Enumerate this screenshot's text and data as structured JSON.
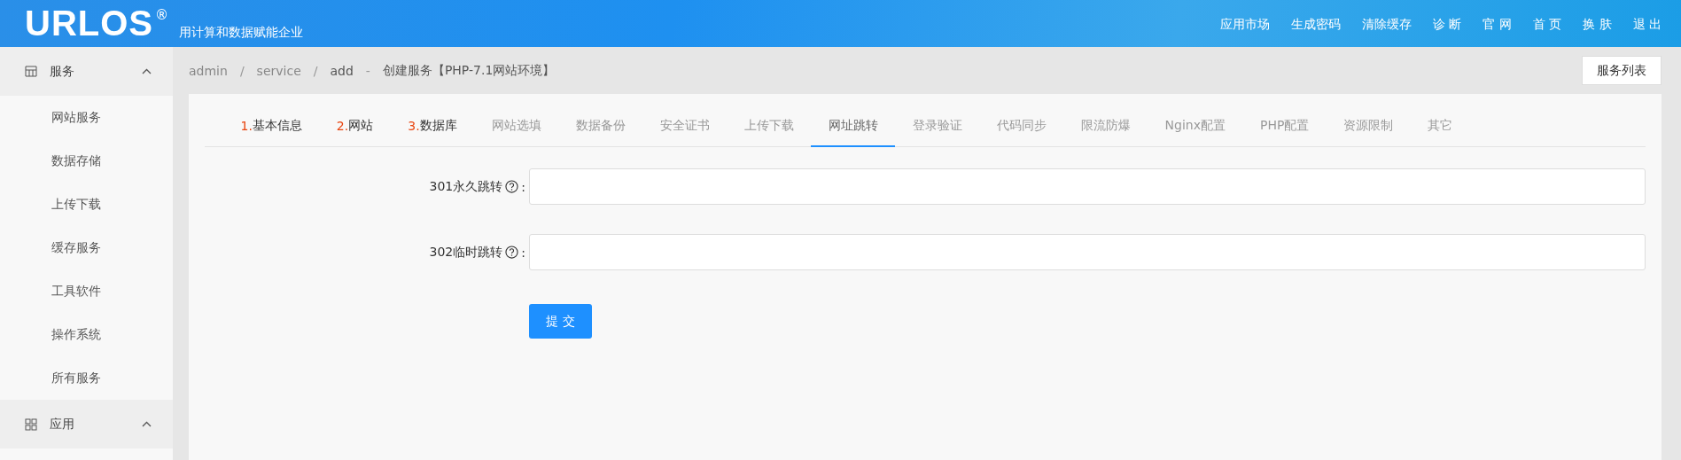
{
  "header": {
    "logo": "URLOS",
    "registered": "®",
    "slogan": "用计算和数据赋能企业",
    "nav": [
      "应用市场",
      "生成密码",
      "清除缓存",
      "诊 断",
      "官 网",
      "首 页",
      "换 肤",
      "退 出"
    ]
  },
  "sidebar": {
    "sections": [
      {
        "label": "服务",
        "kind": "service",
        "expanded": true,
        "items": [
          "网站服务",
          "数据存储",
          "上传下载",
          "缓存服务",
          "工具软件",
          "操作系统",
          "所有服务"
        ]
      },
      {
        "label": "应用",
        "kind": "apps",
        "expanded": true
      }
    ]
  },
  "breadcrumb": [
    {
      "kind": "link",
      "text": "admin"
    },
    {
      "kind": "sep",
      "text": "/"
    },
    {
      "kind": "link",
      "text": "service"
    },
    {
      "kind": "sep",
      "text": "/"
    },
    {
      "kind": "current",
      "text": "add"
    },
    {
      "kind": "sep",
      "text": "-"
    },
    {
      "kind": "current",
      "text": "创建服务【PHP-7.1网站环境】"
    }
  ],
  "list_button": "服务列表",
  "tabs": [
    {
      "number": "1.",
      "label": "基本信息",
      "selected": false
    },
    {
      "number": "2.",
      "label": "网站",
      "selected": false
    },
    {
      "number": "3.",
      "label": "数据库",
      "selected": false
    },
    {
      "label": "网站选填",
      "selected": false
    },
    {
      "label": "数据备份",
      "selected": false
    },
    {
      "label": "安全证书",
      "selected": false
    },
    {
      "label": "上传下载",
      "selected": false
    },
    {
      "label": "网址跳转",
      "selected": true
    },
    {
      "label": "登录验证",
      "selected": false
    },
    {
      "label": "代码同步",
      "selected": false
    },
    {
      "label": "限流防爆",
      "selected": false
    },
    {
      "label": "Nginx配置",
      "selected": false
    },
    {
      "label": "PHP配置",
      "selected": false
    },
    {
      "label": "资源限制",
      "selected": false
    },
    {
      "label": "其它",
      "selected": false
    }
  ],
  "fields": [
    {
      "label": "301永久跳转",
      "colon": ":"
    },
    {
      "label": "302临时跳转",
      "colon": ":"
    }
  ],
  "submit": "提 交"
}
